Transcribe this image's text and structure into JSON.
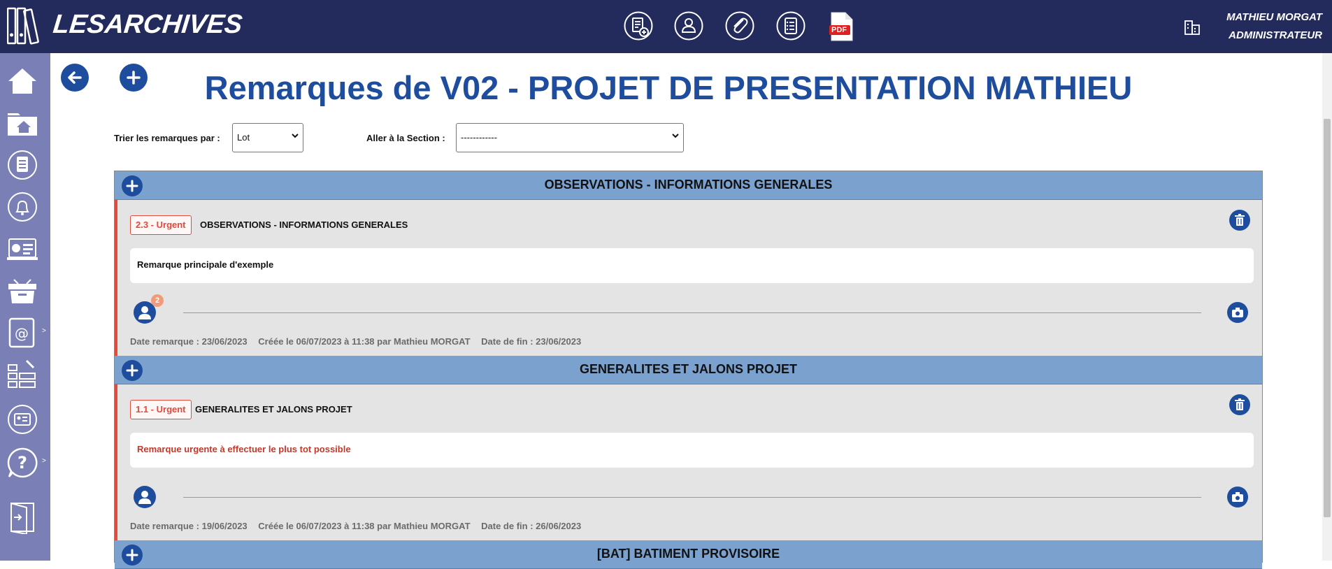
{
  "app": {
    "brand": "LESARCHIVES"
  },
  "topbar": {
    "icons": [
      "new-document-icon",
      "user-icon",
      "attachment-icon",
      "checklist-icon",
      "pdf-icon"
    ],
    "pdf_label": "PDF",
    "user_name": "MATHIEU MORGAT",
    "user_role": "ADMINISTRATEUR"
  },
  "sidebar": {
    "items": [
      "home-icon",
      "folder-home-icon",
      "clipboard-icon",
      "bell-icon",
      "dashboard-icon",
      "archive-box-icon",
      "address-book-icon",
      "planning-icon",
      "id-card-icon",
      "help-icon",
      "logout-door-icon"
    ]
  },
  "page": {
    "title": "Remarques de V02 - PROJET DE PRESENTATION MATHIEU",
    "sort_label": "Trier les remarques par :",
    "sort_value": "Lot",
    "goto_label": "Aller à la Section :",
    "goto_value": "------------"
  },
  "sections": [
    {
      "title": "OBSERVATIONS - INFORMATIONS GENERALES",
      "remark": {
        "badge": "2.3 - Urgent",
        "title": "OBSERVATIONS - INFORMATIONS GENERALES",
        "text": "Remarque principale d'exemple",
        "text_color": "#111111",
        "participants": "2",
        "date_remarque": "Date remarque : 23/06/2023",
        "created": "Créée le 06/07/2023 à 11:38 par Mathieu MORGAT",
        "date_fin": "Date de fin : 23/06/2023"
      }
    },
    {
      "title": "GENERALITES ET JALONS PROJET",
      "remark": {
        "badge": "1.1 - Urgent",
        "title": "GENERALITES ET JALONS PROJET",
        "text": "Remarque urgente à effectuer le plus tot possible",
        "text_color": "#c0392b",
        "date_remarque": "Date remarque : 19/06/2023",
        "created": "Créée le 06/07/2023 à 11:38 par Mathieu MORGAT",
        "date_fin": "Date de fin : 26/06/2023"
      }
    },
    {
      "title": "[BAT] BATIMENT PROVISOIRE"
    }
  ],
  "colors": {
    "accent": "#1e4d9e",
    "topbar": "#232a5c",
    "sidebar": "#7a7fb5",
    "section_header": "#7ba1cf",
    "urgent": "#e04b3b"
  }
}
